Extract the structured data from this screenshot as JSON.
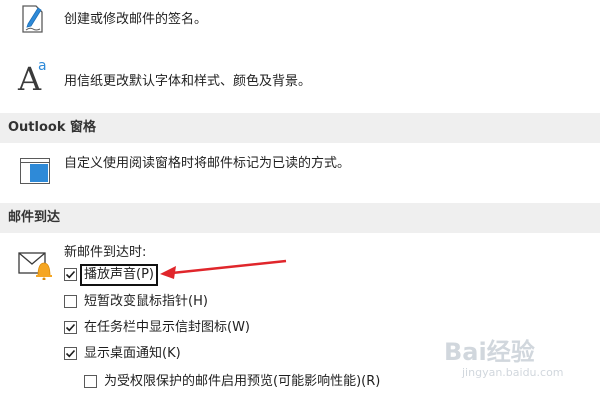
{
  "signature": {
    "description": "创建或修改邮件的签名。",
    "icon": "signature-pen-icon"
  },
  "stationery": {
    "icon_letter_big": "A",
    "icon_letter_small": "a",
    "description": "用信纸更改默认字体和样式、颜色及背景。"
  },
  "reading_pane_section": {
    "header": "Outlook 窗格",
    "description": "自定义使用阅读窗格时将邮件标记为已读的方式。",
    "icon": "reading-pane-icon"
  },
  "mail_arrival_section": {
    "header": "邮件到达",
    "intro": "新邮件到达时:",
    "icon": "envelope-bell-icon",
    "options": [
      {
        "label": "播放声音(P)",
        "checked": true
      },
      {
        "label": "短暂改变鼠标指针(H)",
        "checked": false
      },
      {
        "label": "在任务栏中显示信封图标(W)",
        "checked": true
      },
      {
        "label": "显示桌面通知(K)",
        "checked": true
      },
      {
        "label": "为受权限保护的邮件启用预览(可能影响性能)(R)",
        "checked": false
      }
    ]
  },
  "annotation": {
    "arrow_color": "#e0262b",
    "box_color": "#111111"
  },
  "watermark": {
    "brand": "Bai经验",
    "url": "jingyan.baidu.com"
  }
}
